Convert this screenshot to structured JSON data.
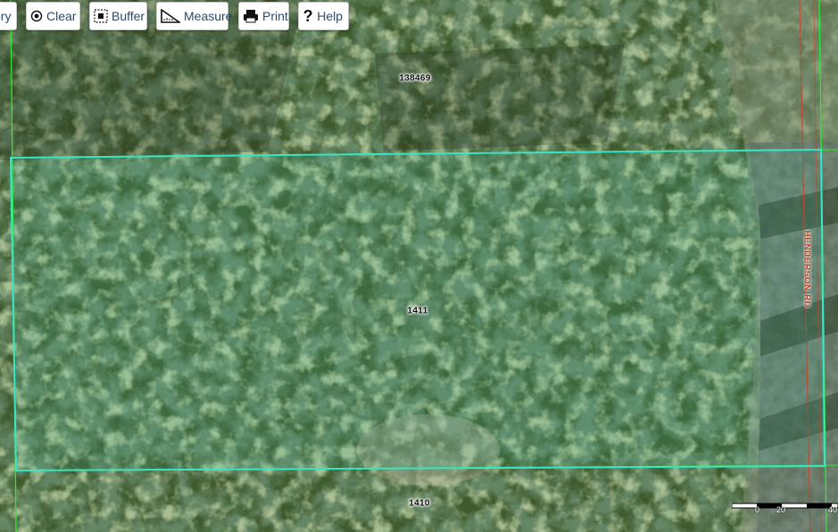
{
  "toolbar": {
    "history_label": "ory",
    "clear_label": "Clear",
    "buffer_label": "Buffer",
    "measure_label": "Measure",
    "print_label": "Print",
    "help_label": "Help"
  },
  "map": {
    "parcels": [
      {
        "id": "138469"
      },
      {
        "id": "1411"
      },
      {
        "id": "1410"
      }
    ],
    "road_name": "HENDERSON RD",
    "selection_color": "#39e6c4",
    "parcel_line_color": "#32e63a",
    "road_line_color": "#c0462e",
    "scale_ticks": [
      "0",
      "20",
      "40"
    ]
  }
}
